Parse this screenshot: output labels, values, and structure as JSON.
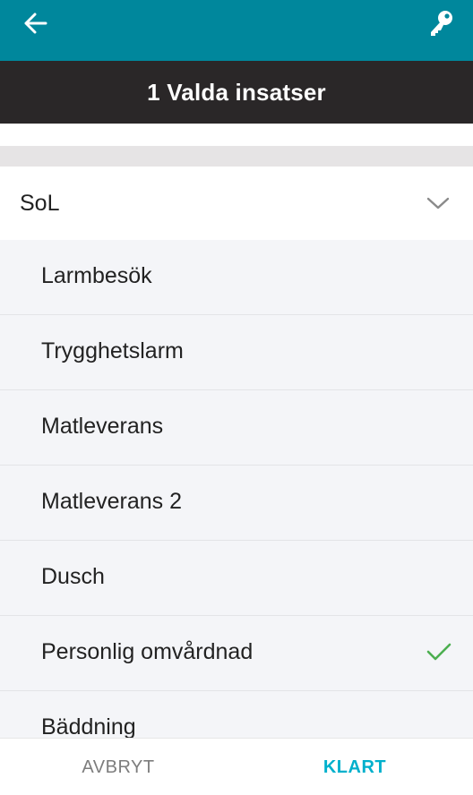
{
  "colors": {
    "appbar": "#00879c",
    "titlebar": "#2a2728",
    "list_background": "#f4f5f8",
    "check": "#4caf50",
    "accent": "#00b0cc"
  },
  "appbar": {
    "back_icon": "arrow-left-icon",
    "key_icon": "key-icon"
  },
  "header": {
    "title": "1 Valda insatser"
  },
  "group": {
    "label": "SoL",
    "icon": "chevron-down-icon"
  },
  "items": [
    {
      "label": "Larmbesök",
      "selected": false
    },
    {
      "label": "Trygghetslarm",
      "selected": false
    },
    {
      "label": "Matleverans",
      "selected": false
    },
    {
      "label": "Matleverans 2",
      "selected": false
    },
    {
      "label": "Dusch",
      "selected": false
    },
    {
      "label": "Personlig omvårdnad",
      "selected": true
    },
    {
      "label": "Bäddning",
      "selected": false
    }
  ],
  "footer": {
    "cancel_label": "AVBRYT",
    "done_label": "KLART"
  }
}
